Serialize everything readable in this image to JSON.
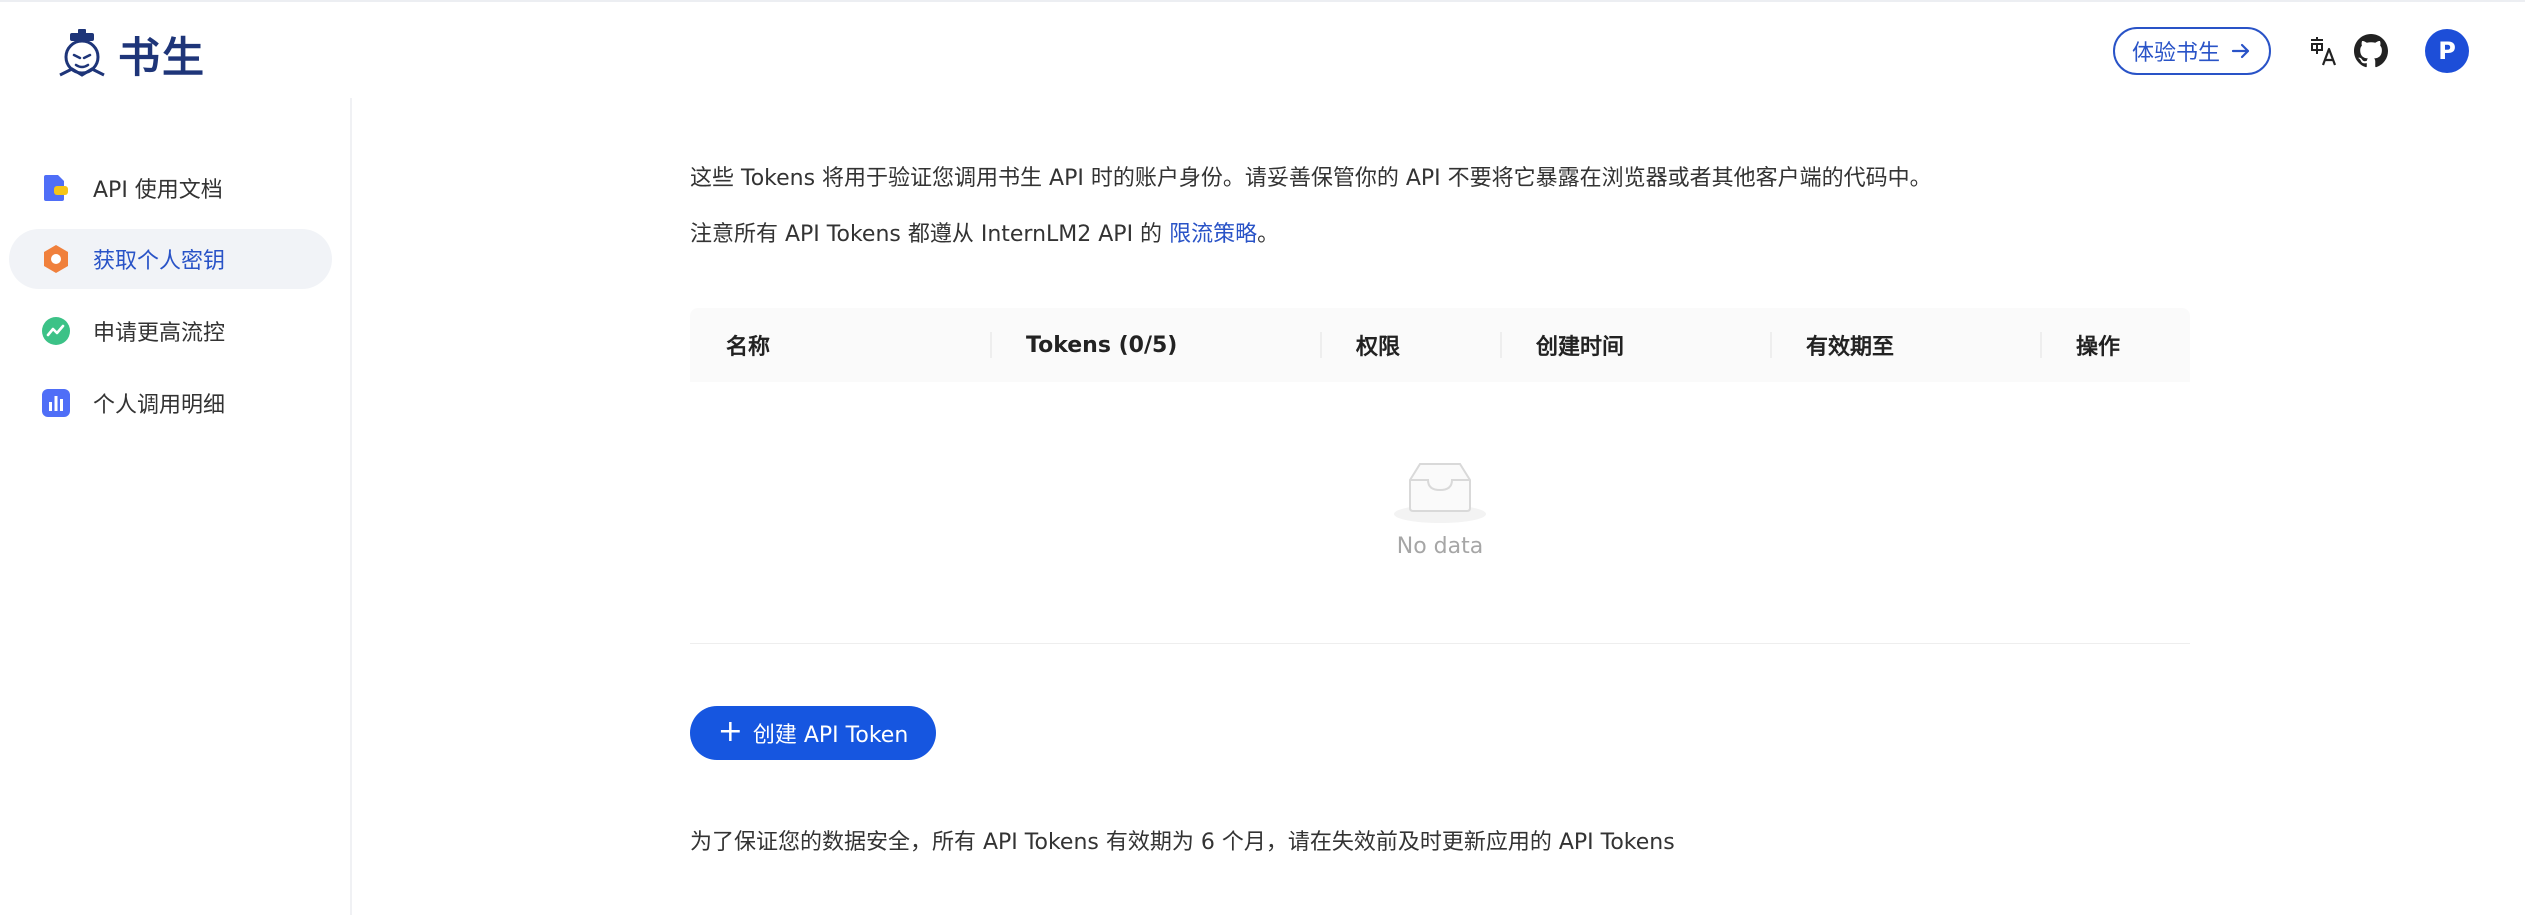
{
  "header": {
    "logo_text": "书生",
    "try_button": "体验书生",
    "avatar_letter": "P"
  },
  "sidebar": {
    "items": [
      {
        "label": "API 使用文档",
        "icon": "document-icon",
        "active": false
      },
      {
        "label": "获取个人密钥",
        "icon": "key-hexagon-icon",
        "active": true
      },
      {
        "label": "申请更高流控",
        "icon": "trend-up-icon",
        "active": false
      },
      {
        "label": "个人调用明细",
        "icon": "bar-chart-icon",
        "active": false
      }
    ]
  },
  "main": {
    "desc_line1": "这些 Tokens 将用于验证您调用书生 API 时的账户身份。请妥善保管你的 API 不要将它暴露在浏览器或者其他客户端的代码中。",
    "desc_line2_prefix": "注意所有 API Tokens 都遵从 InternLM2 API 的 ",
    "desc_line2_link": "限流策略",
    "desc_line2_suffix": "。",
    "table": {
      "columns": [
        "名称",
        "Tokens (0/5)",
        "权限",
        "创建时间",
        "有效期至",
        "操作"
      ],
      "empty_text": "No data"
    },
    "create_button": "创建 API Token",
    "footer_note": "为了保证您的数据安全，所有 API Tokens 有效期为 6 个月，请在失效前及时更新应用的 API Tokens"
  },
  "colors": {
    "brand_blue": "#1656e0",
    "link_blue": "#2953c7",
    "logo_navy": "#1e3579"
  }
}
